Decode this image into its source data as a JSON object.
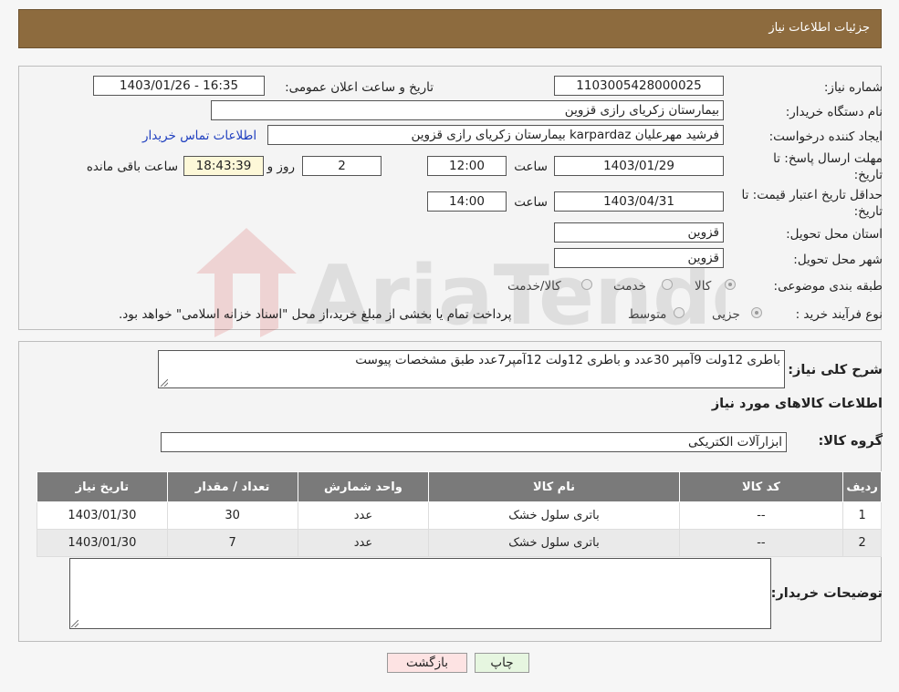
{
  "header": {
    "title": "جزئیات اطلاعات نیاز"
  },
  "form": {
    "need_number_label": "شماره نیاز:",
    "need_number": "1103005428000025",
    "announce_label": "تاریخ و ساعت اعلان عمومی:",
    "announce_value": "1403/01/26 - 16:35",
    "buyer_org_label": "نام دستگاه خریدار:",
    "buyer_org": "بیمارستان زکریای رازی قزوین",
    "creator_label": "ایجاد کننده درخواست:",
    "creator": "فرشید مهرعلیان karpardaz بیمارستان زکریای رازی قزوین",
    "contact_link": "اطلاعات تماس خریدار",
    "deadline_label_1": "مهلت ارسال پاسخ: تا",
    "deadline_label_2": "تاریخ:",
    "deadline_date": "1403/01/29",
    "time_label": "ساعت",
    "deadline_time": "12:00",
    "days_value": "2",
    "days_label": "روز و",
    "remaining_time": "18:43:39",
    "remaining_label": "ساعت باقی مانده",
    "validity_label_1": "حداقل تاریخ اعتبار قیمت: تا",
    "validity_label_2": "تاریخ:",
    "validity_date": "1403/04/31",
    "validity_time": "14:00",
    "province_label": "استان محل تحویل:",
    "province": "قزوین",
    "city_label": "شهر محل تحویل:",
    "city": "قزوین",
    "category_label": "طبقه بندی موضوعی:",
    "category_options": [
      "کالا",
      "خدمت",
      "کالا/خدمت"
    ],
    "process_label": "نوع فرآیند خرید :",
    "process_options": [
      "جزیی",
      "متوسط"
    ],
    "process_note": "پرداخت تمام یا بخشی از مبلغ خرید،از محل \"اسناد خزانه اسلامی\" خواهد بود."
  },
  "details": {
    "desc_label": "شرح کلی نیاز:",
    "desc": "باطری 12ولت 9آمپر 30عدد و باطری 12ولت 12آمپر7عدد طبق مشخصات پیوست",
    "items_title": "اطلاعات کالاهای مورد نیاز",
    "group_label": "گروه کالا:",
    "group": "ابزارآلات الکتریکی",
    "table": {
      "headers": [
        "ردیف",
        "کد کالا",
        "نام کالا",
        "واحد شمارش",
        "تعداد / مقدار",
        "تاریخ نیاز"
      ],
      "rows": [
        [
          "1",
          "--",
          "باتری سلول خشک",
          "عدد",
          "30",
          "1403/01/30"
        ],
        [
          "2",
          "--",
          "باتری سلول خشک",
          "عدد",
          "7",
          "1403/01/30"
        ]
      ]
    },
    "buyer_notes_label": "توضیحات خریدار:",
    "buyer_notes": ""
  },
  "buttons": {
    "print": "چاپ",
    "back": "بازگشت"
  },
  "watermark": {
    "text": "AriaTender.neT"
  },
  "colors": {
    "header": "#8d6b3e",
    "table_header": "#7a7a7a",
    "back_button": "#fde3e3",
    "print_button": "#e6f6e0",
    "link": "#1f3fbf"
  }
}
